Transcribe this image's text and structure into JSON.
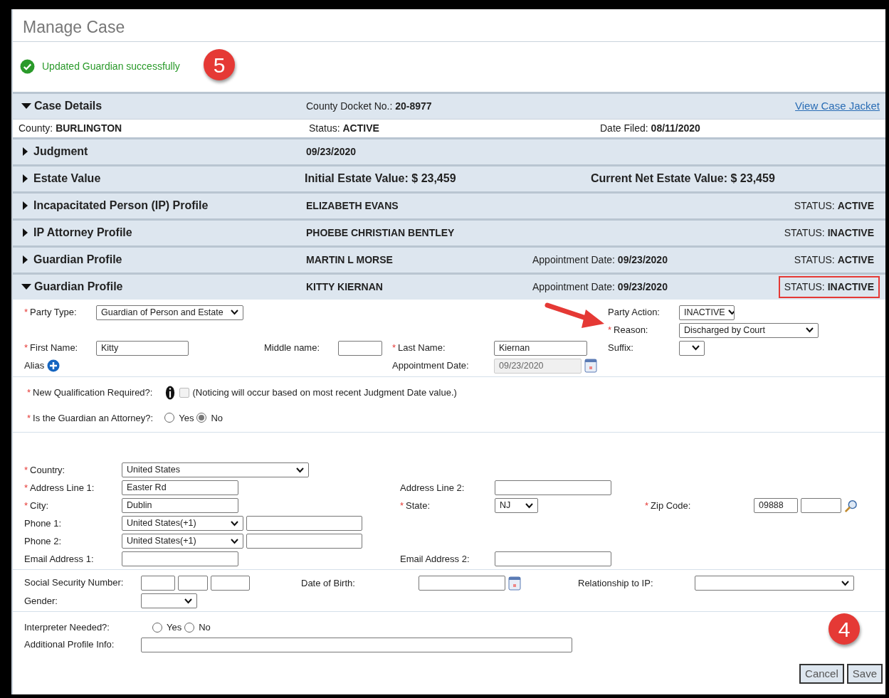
{
  "page_title": "Manage Case",
  "message": {
    "text": "Updated Guardian successfully",
    "kind": "success"
  },
  "step_markers": [
    {
      "label": "5"
    },
    {
      "label": "4"
    }
  ],
  "case_details": {
    "title": "Case Details",
    "expanded": true,
    "docket_label": "County Docket No.:",
    "docket_value": "20-8977",
    "link": "View Case Jacket",
    "details": [
      {
        "label": "County:",
        "value": "BURLINGTON"
      },
      {
        "label": "Status:",
        "value": "ACTIVE"
      },
      {
        "label": "Date Filed:",
        "value": "08/11/2020"
      }
    ]
  },
  "sections": [
    {
      "title": "Judgment",
      "expanded": false,
      "kind": "plain",
      "center": {
        "value": "09/23/2020"
      }
    },
    {
      "title": "Estate Value",
      "expanded": false,
      "kind": "estate",
      "center": {
        "label": "Initial Estate Value:",
        "value": "$ 23,459"
      },
      "right_center": {
        "label": "Current Net Estate Value:",
        "value": "$ 23,459"
      }
    },
    {
      "title": "Incapacitated Person (IP) Profile",
      "expanded": false,
      "kind": "plain",
      "center": {
        "value": "ELIZABETH EVANS"
      },
      "status": {
        "label": "STATUS:",
        "value": "ACTIVE",
        "highlighted": false
      }
    },
    {
      "title": "IP Attorney Profile",
      "expanded": false,
      "kind": "plain",
      "center": {
        "value": "PHOEBE CHRISTIAN BENTLEY"
      },
      "status": {
        "label": "STATUS:",
        "value": "INACTIVE",
        "highlighted": false
      }
    },
    {
      "title": "Guardian Profile",
      "expanded": false,
      "kind": "plain",
      "center": {
        "value": "MARTIN L MORSE"
      },
      "right_center": {
        "label": "Appointment Date:",
        "value": "09/23/2020"
      },
      "status": {
        "label": "STATUS:",
        "value": "ACTIVE",
        "highlighted": false
      }
    },
    {
      "title": "Guardian Profile",
      "expanded": true,
      "kind": "plain",
      "center": {
        "value": "KITTY KIERNAN"
      },
      "right_center": {
        "label": "Appointment Date:",
        "value": "09/23/2020"
      },
      "status": {
        "label": "STATUS:",
        "value": "INACTIVE",
        "highlighted": true
      }
    }
  ],
  "form": {
    "party_type": {
      "label": "Party Type:",
      "required": "*",
      "kind": "select",
      "value": "Guardian of Person and Estate"
    },
    "party_action": {
      "label": "Party Action:",
      "kind": "select",
      "value": "INACTIVE"
    },
    "reason": {
      "label": "Reason:",
      "required": "*",
      "kind": "select",
      "value": "Discharged by Court"
    },
    "first_name": {
      "label": "First Name:",
      "required": "*",
      "kind": "text",
      "value": "Kitty"
    },
    "middle_name": {
      "label": "Middle name:",
      "kind": "text"
    },
    "last_name": {
      "label": "Last Name:",
      "required": "*",
      "kind": "text",
      "value": "Kiernan"
    },
    "suffix": {
      "label": "Suffix:",
      "kind": "select"
    },
    "alias": {
      "label": "Alias",
      "kind": "add"
    },
    "appointment_date": {
      "label": "Appointment Date:",
      "kind": "date",
      "value": "09/23/2020",
      "disabled": true
    },
    "new_qualification": {
      "label": "New Qualification Required?:",
      "required": "*",
      "kind": "checkbox",
      "checked": false,
      "disabled": true,
      "note": "(Noticing will occur based on most recent Judgment Date value.)"
    },
    "is_attorney": {
      "label": "Is the Guardian an Attorney?:",
      "required": "*",
      "kind": "radio",
      "options": [
        {
          "label": "Yes",
          "selected": false
        },
        {
          "label": "No",
          "selected": true
        }
      ]
    },
    "country": {
      "label": "Country:",
      "required": "*",
      "kind": "select",
      "value": "United States"
    },
    "address_line_1": {
      "label": "Address Line 1:",
      "required": "*",
      "kind": "text",
      "value": "Easter Rd"
    },
    "address_line_2": {
      "label": "Address Line 2:",
      "kind": "text"
    },
    "city": {
      "label": "City:",
      "required": "*",
      "kind": "text",
      "value": "Dublin"
    },
    "state": {
      "label": "State:",
      "required": "*",
      "kind": "select",
      "value": "NJ"
    },
    "zip_code": {
      "label": "Zip Code:",
      "required": "*",
      "kind": "zip",
      "value": "09888"
    },
    "phone_1": {
      "label": "Phone 1:",
      "kind": "phone",
      "value": "United States(+1)"
    },
    "phone_2": {
      "label": "Phone 2:",
      "kind": "phone",
      "value": "United States(+1)"
    },
    "email_1": {
      "label": "Email Address 1:",
      "kind": "text"
    },
    "email_2": {
      "label": "Email Address 2:",
      "kind": "text"
    },
    "ssn": {
      "label": "Social Security Number:",
      "kind": "ssn"
    },
    "date_of_birth": {
      "label": "Date of Birth:",
      "kind": "date",
      "disabled": false
    },
    "relationship": {
      "label": "Relationship to IP:",
      "kind": "select"
    },
    "gender": {
      "label": "Gender:",
      "kind": "select"
    },
    "interpreter": {
      "label": "Interpreter Needed?:",
      "kind": "radio",
      "options": [
        {
          "label": "Yes",
          "selected": false
        },
        {
          "label": "No",
          "selected": false
        }
      ]
    },
    "additional_info": {
      "label": "Additional Profile Info:",
      "kind": "text"
    }
  },
  "buttons": [
    "Cancel",
    "Save"
  ]
}
